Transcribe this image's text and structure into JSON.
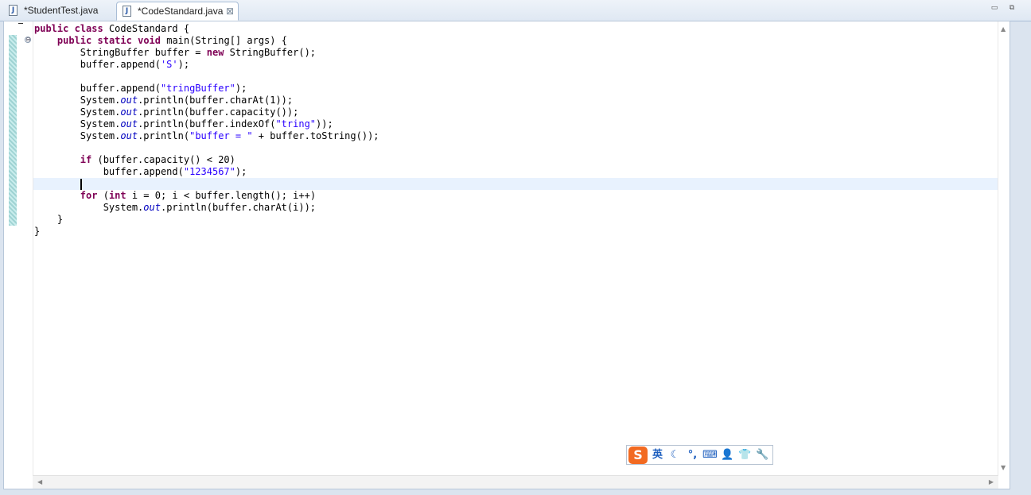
{
  "tabs": [
    {
      "label": "*StudentTest.java",
      "active": false,
      "icon": "java-file-icon"
    },
    {
      "label": "*CodeStandard.java",
      "active": true,
      "icon": "java-file-icon",
      "close_icon": "close-icon"
    }
  ],
  "window_controls": {
    "minimize": "▭",
    "maximize": "⧉"
  },
  "gutter": {
    "fold_symbol": "⊖"
  },
  "editor": {
    "lines": [
      [
        {
          "t": "kw",
          "v": "public"
        },
        {
          "t": "p",
          "v": " "
        },
        {
          "t": "kw",
          "v": "class"
        },
        {
          "t": "p",
          "v": " CodeStandard {"
        }
      ],
      [
        {
          "t": "p",
          "v": "    "
        },
        {
          "t": "kw",
          "v": "public"
        },
        {
          "t": "p",
          "v": " "
        },
        {
          "t": "kw",
          "v": "static"
        },
        {
          "t": "p",
          "v": " "
        },
        {
          "t": "kw",
          "v": "void"
        },
        {
          "t": "p",
          "v": " main(String[] args) {"
        }
      ],
      [
        {
          "t": "p",
          "v": "        StringBuffer buffer = "
        },
        {
          "t": "kw",
          "v": "new"
        },
        {
          "t": "p",
          "v": " StringBuffer();"
        }
      ],
      [
        {
          "t": "p",
          "v": "        buffer.append("
        },
        {
          "t": "str",
          "v": "'S'"
        },
        {
          "t": "p",
          "v": ");"
        }
      ],
      [],
      [
        {
          "t": "p",
          "v": "        buffer.append("
        },
        {
          "t": "str",
          "v": "\"tringBuffer\""
        },
        {
          "t": "p",
          "v": ");"
        }
      ],
      [
        {
          "t": "p",
          "v": "        System."
        },
        {
          "t": "fld",
          "v": "out"
        },
        {
          "t": "p",
          "v": ".println(buffer.charAt(1));"
        }
      ],
      [
        {
          "t": "p",
          "v": "        System."
        },
        {
          "t": "fld",
          "v": "out"
        },
        {
          "t": "p",
          "v": ".println(buffer.capacity());"
        }
      ],
      [
        {
          "t": "p",
          "v": "        System."
        },
        {
          "t": "fld",
          "v": "out"
        },
        {
          "t": "p",
          "v": ".println(buffer.indexOf("
        },
        {
          "t": "str",
          "v": "\"tring\""
        },
        {
          "t": "p",
          "v": "));"
        }
      ],
      [
        {
          "t": "p",
          "v": "        System."
        },
        {
          "t": "fld",
          "v": "out"
        },
        {
          "t": "p",
          "v": ".println("
        },
        {
          "t": "str",
          "v": "\"buffer = \""
        },
        {
          "t": "p",
          "v": " + buffer.toString());"
        }
      ],
      [],
      [
        {
          "t": "p",
          "v": "        "
        },
        {
          "t": "kw",
          "v": "if"
        },
        {
          "t": "p",
          "v": " (buffer.capacity() < 20)"
        }
      ],
      [
        {
          "t": "p",
          "v": "            buffer.append("
        },
        {
          "t": "str",
          "v": "\"1234567\""
        },
        {
          "t": "p",
          "v": ");"
        }
      ],
      [
        {
          "t": "p",
          "v": "        "
        }
      ],
      [
        {
          "t": "p",
          "v": "        "
        },
        {
          "t": "kw",
          "v": "for"
        },
        {
          "t": "p",
          "v": " ("
        },
        {
          "t": "kw",
          "v": "int"
        },
        {
          "t": "p",
          "v": " i = 0; i < buffer.length(); i++)"
        }
      ],
      [
        {
          "t": "p",
          "v": "            System."
        },
        {
          "t": "fld",
          "v": "out"
        },
        {
          "t": "p",
          "v": ".println(buffer.charAt(i));"
        }
      ],
      [
        {
          "t": "p",
          "v": "    }"
        }
      ],
      [
        {
          "t": "p",
          "v": "}"
        }
      ]
    ],
    "current_line": 13
  },
  "ime_toolbar": {
    "logo": "S",
    "items": [
      {
        "name": "language-toggle",
        "label": "英"
      },
      {
        "name": "moon-icon",
        "label": "☾"
      },
      {
        "name": "punctuation-icon",
        "label": "°,"
      },
      {
        "name": "keyboard-icon",
        "label": "⌨"
      },
      {
        "name": "user-icon",
        "label": "👤"
      },
      {
        "name": "shirt-icon",
        "label": "👕"
      },
      {
        "name": "wrench-icon",
        "label": "🔧"
      }
    ]
  },
  "colors": {
    "keyword": "#7f0055",
    "string": "#2a00ff",
    "field": "#0000c0",
    "current_line": "#e8f2fe"
  }
}
